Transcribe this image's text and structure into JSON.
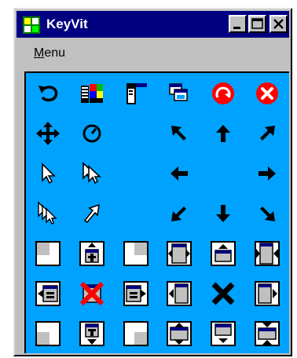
{
  "window": {
    "title": "KeyVit",
    "icon": "keyvit-app-icon"
  },
  "titlebar_buttons": [
    "minimize",
    "maximize",
    "close"
  ],
  "menu": [
    {
      "label": "Menu"
    }
  ],
  "colors": {
    "titlebar": "#000080",
    "window_face": "#c0c0c0",
    "client_background": "#00a2ff",
    "close_circle": "#ff0000",
    "delete_cross": "#ff0000"
  },
  "toolbar_grid": [
    [
      "undo-icon",
      "color-palette-icon",
      "window-tools-icon",
      "multiple-windows-icon",
      "stop-icon",
      "close-circle-icon"
    ],
    [
      "move-icon",
      "clock-icon",
      "",
      "arrow-up-left-icon",
      "arrow-up-icon",
      "arrow-up-right-icon"
    ],
    [
      "pointer-icon",
      "double-pointer-icon",
      "",
      "arrow-left-icon",
      "",
      "arrow-right-icon"
    ],
    [
      "triple-pointer-icon",
      "white-arrow-icon",
      "",
      "arrow-down-left-icon",
      "arrow-down-icon",
      "arrow-down-right-icon"
    ],
    [
      "window-corner-top-left-icon",
      "window-shrink-center-icon",
      "window-corner-top-right-icon",
      "window-expand-horizontal-icon",
      "window-move-top-icon",
      "window-shrink-right-icon"
    ],
    [
      "window-shrink-left-icon",
      "window-delete-icon",
      "window-expand-right-icon",
      "window-move-left-icon",
      "close-x-icon",
      "window-move-right-icon"
    ],
    [
      "window-corner-bottom-left-icon",
      "window-shrink-down-icon",
      "window-corner-bottom-right-icon",
      "window-expand-vertical-icon",
      "window-move-bottom-icon",
      "window-shrink-vertical-icon"
    ]
  ]
}
